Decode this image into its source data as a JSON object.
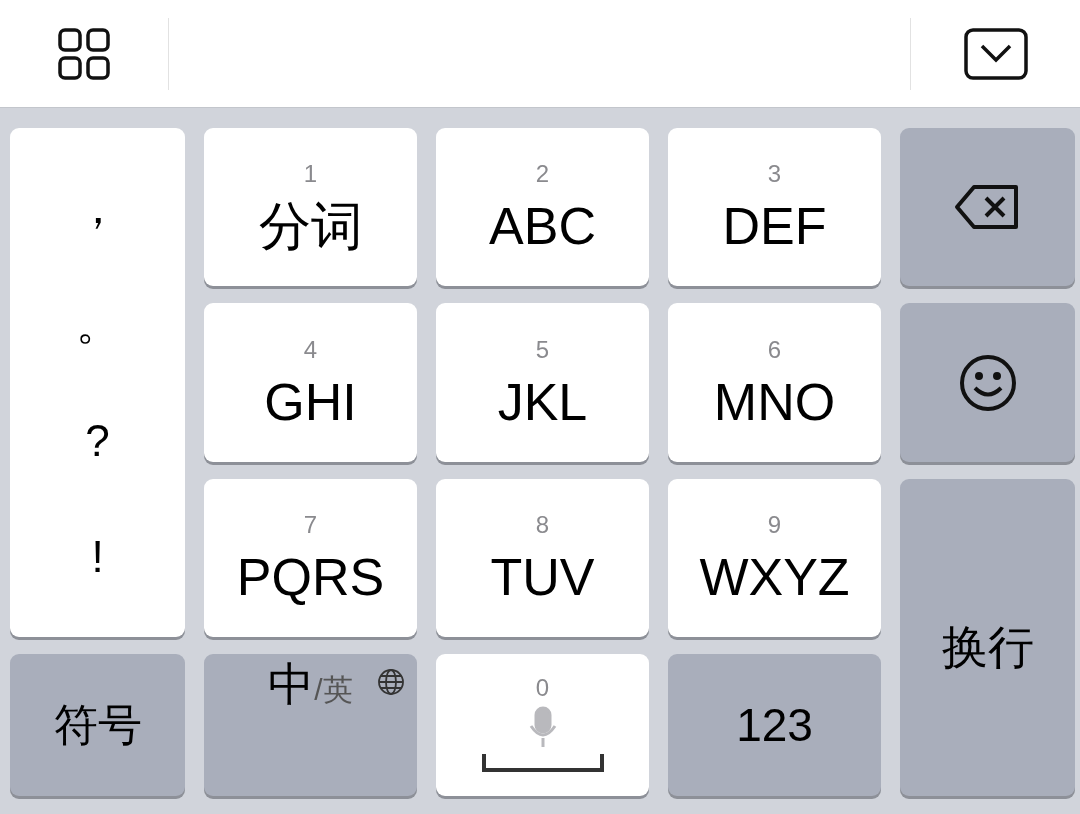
{
  "punctuation": [
    "，",
    "。",
    "?",
    "!"
  ],
  "keys": [
    {
      "number": "1",
      "label": "分词"
    },
    {
      "number": "2",
      "label": "ABC"
    },
    {
      "number": "3",
      "label": "DEF"
    },
    {
      "number": "4",
      "label": "GHI"
    },
    {
      "number": "5",
      "label": "JKL"
    },
    {
      "number": "6",
      "label": "MNO"
    },
    {
      "number": "7",
      "label": "PQRS"
    },
    {
      "number": "8",
      "label": "TUV"
    },
    {
      "number": "9",
      "label": "WXYZ"
    }
  ],
  "symbol_key": "符号",
  "language_key": {
    "main": "中",
    "alt": "/英"
  },
  "space_key": {
    "number": "0"
  },
  "number_key": "123",
  "return_key": "换行"
}
